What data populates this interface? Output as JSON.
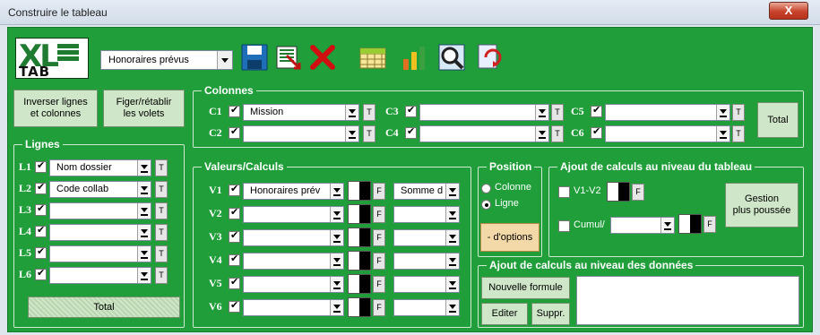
{
  "window": {
    "title": "Construire le tableau",
    "close": "X"
  },
  "toolbar": {
    "logo_top": "XL",
    "logo_bottom": "TAB",
    "preset": "Honoraires prévus",
    "icons": [
      "save-icon",
      "export-icon",
      "delete-icon",
      "table-icon",
      "chart-icon",
      "preview-icon",
      "refresh-icon"
    ]
  },
  "actions": {
    "swap": "Inverser lignes\net colonnes",
    "freeze": "Figer/rétablir\nles volets"
  },
  "colonnes": {
    "legend": "Colonnes",
    "items": [
      {
        "label": "C1",
        "checked": true,
        "value": "Mission"
      },
      {
        "label": "C2",
        "checked": true,
        "value": ""
      },
      {
        "label": "C3",
        "checked": true,
        "value": ""
      },
      {
        "label": "C4",
        "checked": true,
        "value": ""
      },
      {
        "label": "C5",
        "checked": true,
        "value": ""
      },
      {
        "label": "C6",
        "checked": true,
        "value": ""
      }
    ],
    "total": "Total",
    "t": "T"
  },
  "lignes": {
    "legend": "Lignes",
    "items": [
      {
        "label": "L1",
        "checked": true,
        "value": "Nom dossier"
      },
      {
        "label": "L2",
        "checked": true,
        "value": "Code collab"
      },
      {
        "label": "L3",
        "checked": true,
        "value": ""
      },
      {
        "label": "L4",
        "checked": true,
        "value": ""
      },
      {
        "label": "L5",
        "checked": true,
        "value": ""
      },
      {
        "label": "L6",
        "checked": true,
        "value": ""
      }
    ],
    "total": "Total"
  },
  "valeurs": {
    "legend": "Valeurs/Calculs",
    "f": "F",
    "items": [
      {
        "label": "V1",
        "checked": true,
        "value": "Honoraires prév",
        "agg": "Somme d"
      },
      {
        "label": "V2",
        "checked": true,
        "value": "",
        "agg": ""
      },
      {
        "label": "V3",
        "checked": true,
        "value": "",
        "agg": ""
      },
      {
        "label": "V4",
        "checked": true,
        "value": "",
        "agg": ""
      },
      {
        "label": "V5",
        "checked": true,
        "value": "",
        "agg": ""
      },
      {
        "label": "V6",
        "checked": true,
        "value": "",
        "agg": ""
      }
    ]
  },
  "position": {
    "legend": "Position",
    "colonne": "Colonne",
    "ligne": "Ligne",
    "selected": "Ligne",
    "options": "- d'options"
  },
  "tableau_calc": {
    "legend": "Ajout de calculs au niveau du tableau",
    "v1v2": "V1-V2",
    "cumul": "Cumul/",
    "gestion": "Gestion\nplus poussée"
  },
  "donnees_calc": {
    "legend": "Ajout de calculs au niveau des données",
    "nouvelle": "Nouvelle formule",
    "editer": "Editer",
    "suppr": "Suppr."
  }
}
